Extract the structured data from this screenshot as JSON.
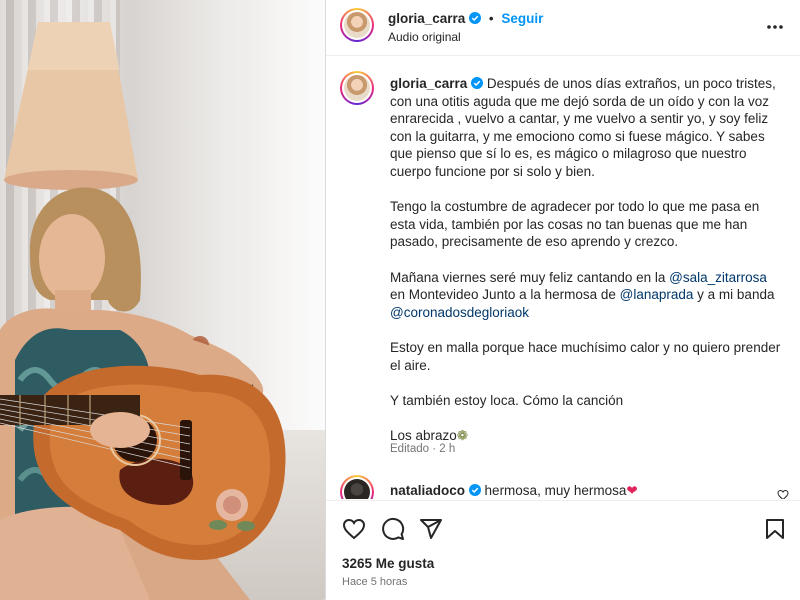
{
  "header": {
    "username": "gloria_carra",
    "separator": "•",
    "follow_label": "Seguir",
    "audio_label": "Audio original",
    "more_icon": "more-horizontal-icon"
  },
  "caption": {
    "username": "gloria_carra",
    "para1": "Después de unos días extraños, un poco tristes, con una otitis aguda que me dejó sorda de un oído y con la voz enrarecida , vuelvo a cantar, y me vuelvo a sentir yo, y soy feliz con la guitarra, y me emociono como si fuese mágico. Y sabes que pienso que sí lo es, es mágico o milagroso que nuestro cuerpo funcione por si solo y bien.",
    "para2": "Tengo la costumbre de agradecer por todo lo que me pasa en esta vida, también por las cosas no tan buenas que me han pasado, precisamente de eso aprendo y crezco.",
    "para3_a": "Mañana viernes seré muy feliz cantando en la ",
    "mention1": "@sala_zitarrosa",
    "para3_b": " en Montevideo Junto a la hermosa de ",
    "mention2": "@lanaprada",
    "para3_c": " y a mi banda ",
    "mention3": "@coronadosdegloriaok",
    "para4": "Estoy en malla porque hace muchísimo calor y no quiero prender el aire.",
    "para5": "Y también estoy loca. Cómo la canción",
    "para6": "Los abrazo",
    "para6_emoji": "❁",
    "edited": "Editado · 2 h"
  },
  "comment": {
    "username": "nataliadoco",
    "text": "hermosa, muy hermosa",
    "emoji": "❤"
  },
  "actions": {
    "like_icon": "heart-icon",
    "comment_icon": "comment-icon",
    "share_icon": "share-icon",
    "save_icon": "bookmark-icon"
  },
  "likes": "3265 Me gusta",
  "timestamp": "Hace 5 horas",
  "colors": {
    "link": "#0095f6",
    "mention": "#00376b",
    "verified": "#0095f6",
    "heart": "#ed4956"
  }
}
